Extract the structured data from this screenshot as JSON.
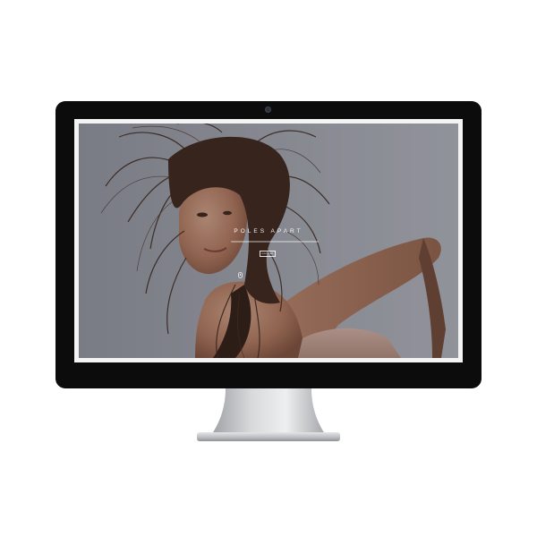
{
  "site": {
    "title": "POLES APART",
    "cta_label": "DISCOVER"
  },
  "icons": {
    "camera": "webcam-icon",
    "scroll": "mouse-scroll-icon"
  },
  "colors": {
    "bezel": "#0c0c0c",
    "screen_bg": "#9a9ca4",
    "text": "#ffffff"
  }
}
